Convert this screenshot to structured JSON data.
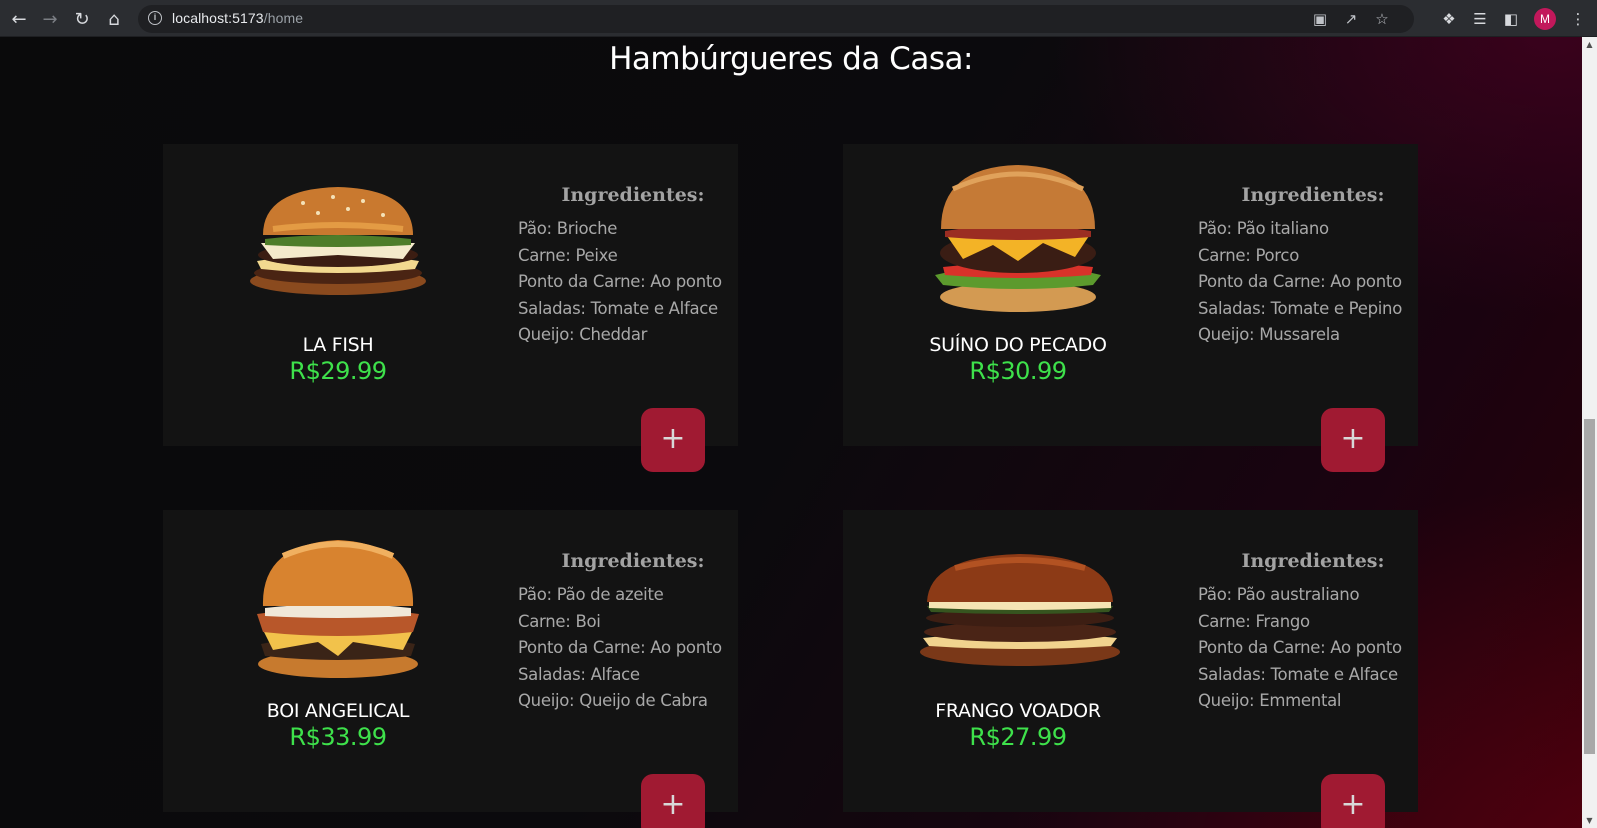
{
  "browser": {
    "url_host": "localhost:5173",
    "url_path": "/home",
    "profile_initial": "M"
  },
  "page": {
    "title": "Hambúrgueres da Casa:",
    "ingredients_heading": "Ingredientes:",
    "add_symbol": "+"
  },
  "products": [
    {
      "name": "LA FISH",
      "price": "R$29.99",
      "ingredients": [
        "Pão: Brioche",
        "Carne: Peixe",
        "Ponto da Carne: Ao ponto",
        "Saladas: Tomate e Alface",
        "Queijo: Cheddar"
      ]
    },
    {
      "name": "SUÍNO DO PECADO",
      "price": "R$30.99",
      "ingredients": [
        "Pão: Pão italiano",
        "Carne: Porco",
        "Ponto da Carne: Ao ponto",
        "Saladas: Tomate e Pepino",
        "Queijo: Mussarela"
      ]
    },
    {
      "name": "BOI ANGELICAL",
      "price": "R$33.99",
      "ingredients": [
        "Pão: Pão de azeite",
        "Carne: Boi",
        "Ponto da Carne: Ao ponto",
        "Saladas: Alface",
        "Queijo: Queijo de Cabra"
      ]
    },
    {
      "name": "FRANGO VOADOR",
      "price": "R$27.99",
      "ingredients": [
        "Pão: Pão australiano",
        "Carne: Frango",
        "Ponto da Carne: Ao ponto",
        "Saladas: Tomate e Alface",
        "Queijo: Emmental"
      ]
    }
  ],
  "colors": {
    "price": "#3ee14b",
    "add_button": "#a01a32",
    "card_bg": "#131313"
  }
}
